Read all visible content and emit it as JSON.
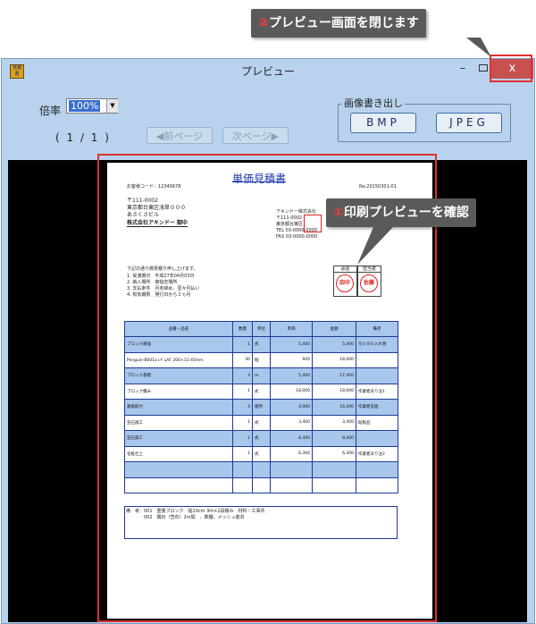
{
  "window": {
    "title": "プレビュー",
    "app_icon_text": "見積書",
    "minimize_glyph": "–",
    "close_glyph": "x"
  },
  "toolbar": {
    "zoom_label": "倍率",
    "zoom_value": "100%",
    "page_counter": "( 1 / 1 )",
    "prev_page": "◀前ページ",
    "next_page": "次ページ▶",
    "export_group_label": "画像書き出し",
    "bmp_button": "BMP",
    "jpeg_button": "JPEG"
  },
  "callouts": {
    "close_number": "②",
    "close_text": "プレビュー画面を閉じます",
    "preview_number": "①",
    "preview_text": "印刷プレビューを確認"
  },
  "document": {
    "title": "単価見積書",
    "customer_no": "お客様コード：12345678",
    "doc_no": "No.20150301-01",
    "address_lines": [
      "〒111-0002",
      "東京都台東区浅草０００",
      "あさくさビル"
    ],
    "company": "株式会社アキンドー 御中",
    "issuer_lines": [
      "アキンドー株式会社",
      "〒111-0002",
      "東京都台東区",
      "TEL 03-0000-0000",
      "FAX 03-0000-0000"
    ],
    "intro_lines": [
      "下記の通り御見積り申し上げます。",
      "1. 受渡期日　平成27年04月03日",
      "2. 納入場所　御指定場所",
      "3. 支払条件　月末締め、翌々月払い",
      "4. 有効期限　発行日から３ヵ月"
    ],
    "stamp_labels": [
      "承認",
      "担当者"
    ],
    "hanko_1": "田中",
    "hanko_2": "佐藤",
    "remark_lines": [
      "備　考：001　重量ブロック　幅10cm 3m×2段積み　材料・工事共",
      "　　　　002　隅石（笠石）2m間　、数種、メッシュ筋共"
    ]
  },
  "table": {
    "headers": [
      "品番・品名",
      "数量",
      "単位",
      "単価",
      "金額",
      "備考"
    ],
    "rows": [
      [
        "ブロック補強",
        "1",
        "式",
        "5,400",
        "5,400",
        "モルタル入れ替"
      ],
      [
        "Penguin-B001a\nﾚｷﾞﾑAF 200×11-45mm",
        "30",
        "個",
        "600",
        "18,000",
        ""
      ],
      [
        "ブロック基礎",
        "3",
        "m",
        "5,400",
        "17,400",
        ""
      ],
      [
        "ブロック積み",
        "1",
        "式",
        "18,000",
        "18,000",
        "作業者あり注1"
      ],
      [
        "鉄筋取付",
        "4",
        "箇所",
        "4,000",
        "16,000",
        "作業者支給"
      ],
      [
        "笠石施工",
        "1",
        "式",
        "3,400",
        "3,400",
        "既製品"
      ],
      [
        "笠石施工",
        "1",
        "式",
        "8,400",
        "8,400",
        ""
      ],
      [
        "化粧仕上",
        "1",
        "式",
        "6,300",
        "6,300",
        "作業者あり注2"
      ],
      [
        "",
        "",
        "",
        "",
        "",
        ""
      ],
      [
        "",
        "",
        "",
        "",
        "",
        ""
      ]
    ]
  },
  "colors": {
    "window_bg": "#b9d3ee",
    "close_button": "#c75050",
    "highlight_frame": "#e03030",
    "table_border": "#1d3b96",
    "table_stripe": "#a9c6ec",
    "callout_bg": "#5a5a5a"
  }
}
